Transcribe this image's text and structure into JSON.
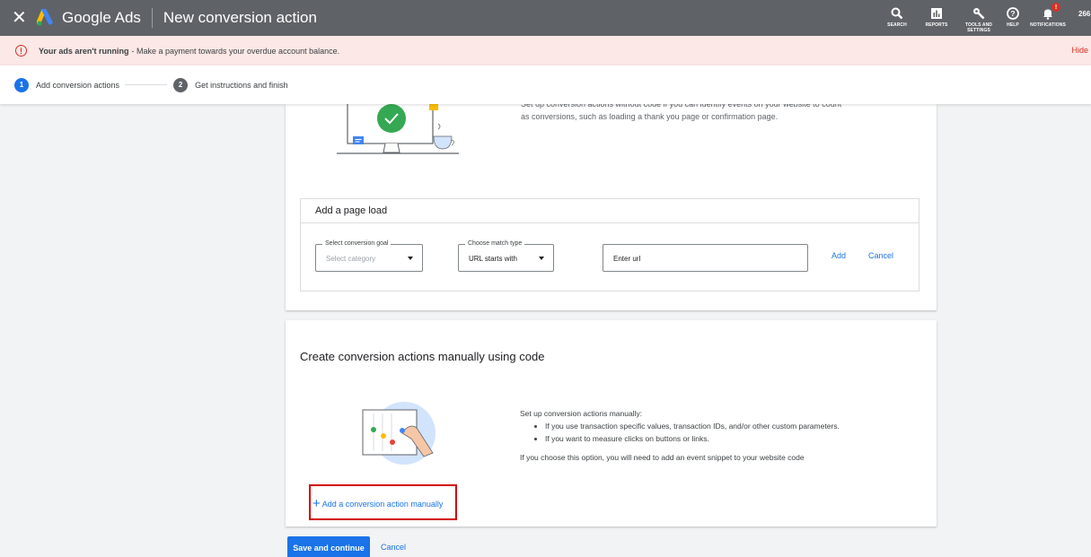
{
  "topbar": {
    "brand": "Google Ads",
    "title": "New conversion action",
    "tools": [
      {
        "label": "SEARCH",
        "icon": "search-icon"
      },
      {
        "label": "REPORTS",
        "icon": "reports-icon"
      },
      {
        "label": "TOOLS AND SETTINGS",
        "icon": "wrench-icon"
      },
      {
        "label": "HELP",
        "icon": "help-icon"
      },
      {
        "label": "NOTIFICATIONS",
        "icon": "bell-icon"
      }
    ],
    "account": "266"
  },
  "alert": {
    "title": "Your ads aren't running",
    "message": "- Make a payment towards your overdue account balance.",
    "hide": "Hide"
  },
  "stepper": {
    "steps": [
      {
        "num": "1",
        "label": "Add conversion actions"
      },
      {
        "num": "2",
        "label": "Get instructions and finish"
      }
    ]
  },
  "card1": {
    "desc_line1": "Set up conversion actions without code if you can identify events on your website to count",
    "desc_line2": "as conversions, such as loading a thank you page or confirmation page.",
    "pageload": {
      "heading": "Add a page load",
      "goal_label": "Select conversion goal",
      "goal_placeholder": "Select category",
      "match_label": "Choose match type",
      "match_value": "URL starts with",
      "url_placeholder": "Enter url",
      "add": "Add",
      "cancel": "Cancel"
    }
  },
  "card2": {
    "title": "Create conversion actions manually using code",
    "intro": "Set up conversion actions manually:",
    "bullets": [
      "If you use transaction specific values, transaction IDs, and/or other custom parameters.",
      "If you want to measure clicks on buttons or links."
    ],
    "note": "If you choose this option, you will need to add an event snippet to your website code",
    "add_manual": "Add a conversion action manually"
  },
  "footer": {
    "save": "Save and continue",
    "cancel": "Cancel"
  },
  "colors": {
    "accent": "#1a73e8",
    "topbar": "#5f6368",
    "alert_bg": "#fce8e6",
    "highlight": "#d40000"
  }
}
